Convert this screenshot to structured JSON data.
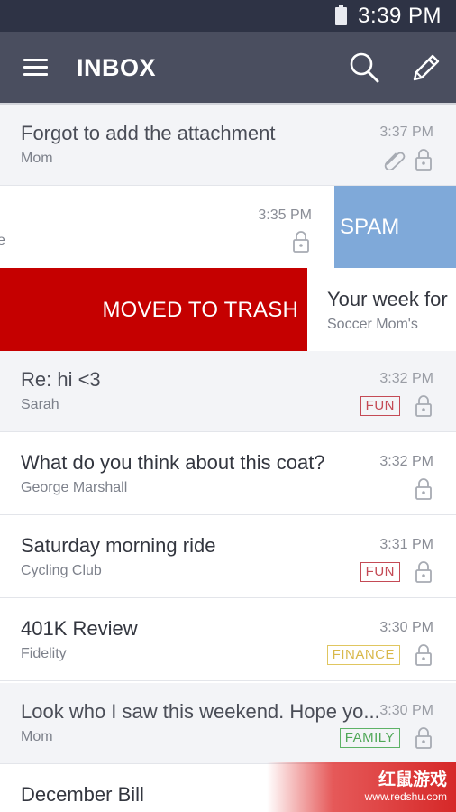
{
  "status_bar": {
    "time": "3:39 PM"
  },
  "app_bar": {
    "title": "INBOX"
  },
  "emails": [
    {
      "subject": "Forgot to add the attachment",
      "sender": "Mom",
      "time": "3:37 PM"
    },
    {
      "subject": "",
      "sender": "e",
      "time": "3:35 PM",
      "swipe_action": "SPAM"
    },
    {
      "subject": "Your week for",
      "sender": "Soccer Mom's",
      "swipe_action": "MOVED TO TRASH"
    },
    {
      "subject": "Re: hi <3",
      "sender": "Sarah",
      "time": "3:32 PM",
      "tag": "FUN"
    },
    {
      "subject": "What do you think about this coat?",
      "sender": "George Marshall",
      "time": "3:32 PM"
    },
    {
      "subject": "Saturday morning ride",
      "sender": "Cycling Club",
      "time": "3:31 PM",
      "tag": "FUN"
    },
    {
      "subject": "401K Review",
      "sender": "Fidelity",
      "time": "3:30 PM",
      "tag": "FINANCE"
    },
    {
      "subject": "Look who I saw this weekend. Hope yo...",
      "sender": "Mom",
      "time": "3:30 PM",
      "tag": "FAMILY"
    },
    {
      "subject": "December Bill"
    }
  ],
  "watermark": {
    "text": "红鼠游戏",
    "url": "www.redshu.com"
  },
  "colors": {
    "app_bar": "#4a4e5f",
    "status_bar": "#2e3345",
    "spam": "#7fa9d9",
    "trash": "#c50000",
    "fun": "#c44a55",
    "finance": "#e0c660",
    "family": "#5db266"
  },
  "icons": [
    "battery-icon",
    "menu-icon",
    "search-icon",
    "compose-icon",
    "attachment-icon",
    "lock-icon"
  ]
}
